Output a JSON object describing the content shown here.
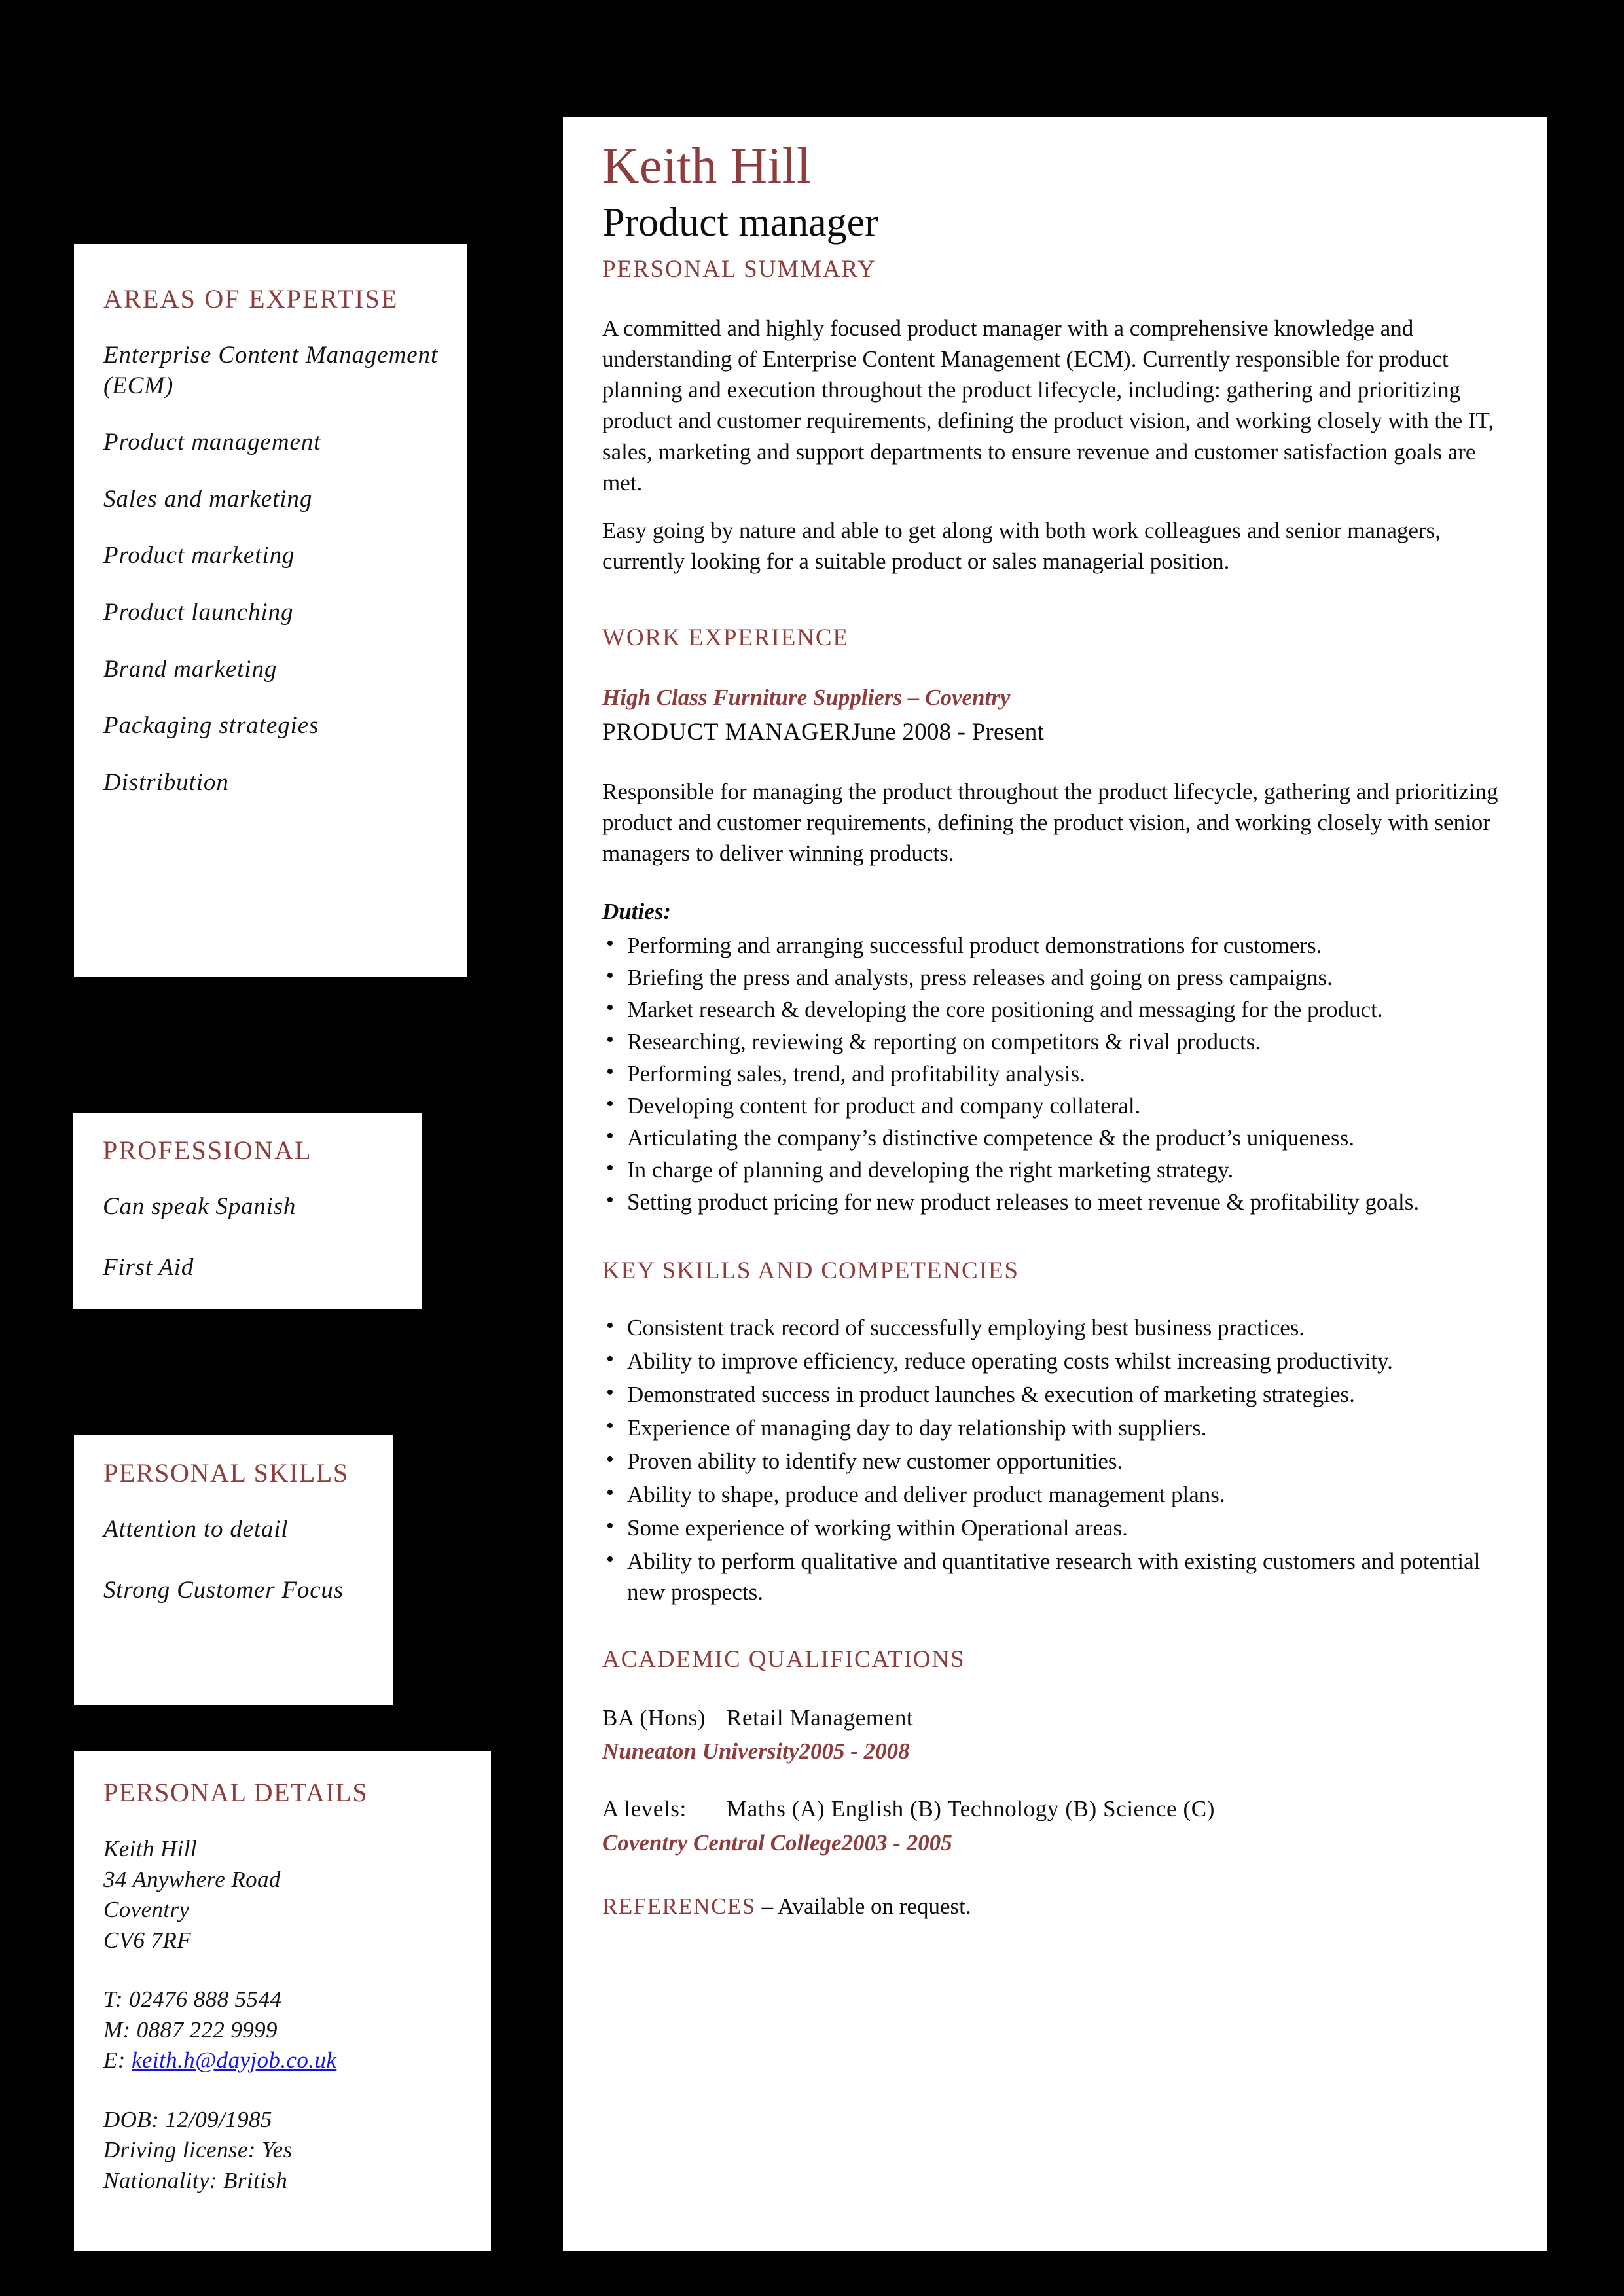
{
  "theme": {
    "accent": "#8e3c3c",
    "background": "#000000",
    "panel": "#ffffff",
    "link": "#1414e6",
    "text": "#0d0d0d"
  },
  "header": {
    "name": "Keith Hill",
    "role": "Product manager"
  },
  "sidebar": {
    "expertise": {
      "heading": "AREAS OF EXPERTISE",
      "items": [
        "Enterprise Content Management (ECM)",
        "Product management",
        "Sales and marketing",
        "Product marketing",
        "Product launching",
        "Brand marketing",
        "Packaging strategies",
        "Distribution"
      ]
    },
    "professional": {
      "heading": "PROFESSIONAL",
      "items": [
        "Can speak Spanish",
        "First Aid"
      ]
    },
    "personal_skills": {
      "heading": "PERSONAL SKILLS",
      "items": [
        "Attention to detail",
        "Strong Customer Focus"
      ]
    },
    "personal_details": {
      "heading": "PERSONAL DETAILS",
      "address": [
        "Keith Hill",
        "34 Anywhere Road",
        "Coventry",
        "CV6 7RF"
      ],
      "phone_label_t": "T: 02476 888 5544",
      "phone_label_m": "M: 0887 222 9999",
      "email_label": "E:",
      "email": "keith.h@dayjob.co.uk",
      "dob": "DOB: 12/09/1985",
      "driving_license": "Driving license:  Yes",
      "nationality": "Nationality: British"
    }
  },
  "main": {
    "summary": {
      "heading": "PERSONAL SUMMARY",
      "paragraphs": [
        "A committed and highly focused product manager with a comprehensive knowledge and understanding of Enterprise Content Management (ECM). Currently responsible for product planning and execution throughout the product lifecycle, including: gathering and prioritizing product and customer requirements, defining the product vision, and working closely with the IT, sales, marketing and support departments to ensure revenue and customer satisfaction goals are met.",
        "Easy going by nature and able to get along with both work colleagues and senior managers, currently looking for a suitable product or sales managerial position."
      ]
    },
    "work_experience": {
      "heading": "WORK EXPERIENCE",
      "company": "High Class Furniture Suppliers – Coventry",
      "job_title": "PRODUCT MANAGER",
      "dates": "June 2008 - Present",
      "description": "Responsible for managing the product throughout the product lifecycle, gathering and prioritizing product and customer requirements, defining the product vision, and working closely with senior managers to deliver winning products.",
      "duties_label": "Duties:",
      "duties": [
        "Performing and arranging successful product demonstrations for customers.",
        "Briefing the press and analysts, press releases and going on press campaigns.",
        "Market research & developing the core positioning and messaging for the product.",
        "Researching, reviewing & reporting on competitors & rival products.",
        "Performing sales, trend, and profitability analysis.",
        "Developing content for product and company collateral.",
        "Articulating the company’s distinctive competence & the product’s uniqueness.",
        "In charge of planning and developing the right marketing strategy.",
        "Setting product pricing for new product releases to meet revenue & profitability goals."
      ]
    },
    "key_skills": {
      "heading": "KEY SKILLS AND COMPETENCIES",
      "items": [
        "Consistent track record of successfully employing best business practices.",
        "Ability to improve efficiency, reduce operating costs whilst increasing productivity.",
        "Demonstrated success in product launches & execution of marketing strategies.",
        "Experience of managing day to day relationship with suppliers.",
        "Proven ability to identify new customer opportunities.",
        "Ability to shape, produce and deliver product management plans.",
        "Some experience of working within Operational areas.",
        "Ability to perform qualitative and quantitative research with existing customers and potential new prospects."
      ]
    },
    "academic": {
      "heading": "ACADEMIC QUALIFICATIONS",
      "degree_label": "BA (Hons)",
      "degree_subject": "Retail Management",
      "degree_institution": "Nuneaton University",
      "degree_years": "2005 - 2008",
      "alevels_label": "A levels:",
      "alevels_subjects": "Maths (A) English (B) Technology (B) Science (C)",
      "alevels_institution": "Coventry Central College",
      "alevels_years": "2003 - 2005"
    },
    "references": {
      "heading": "REFERENCES",
      "text": " – Available on request."
    }
  }
}
